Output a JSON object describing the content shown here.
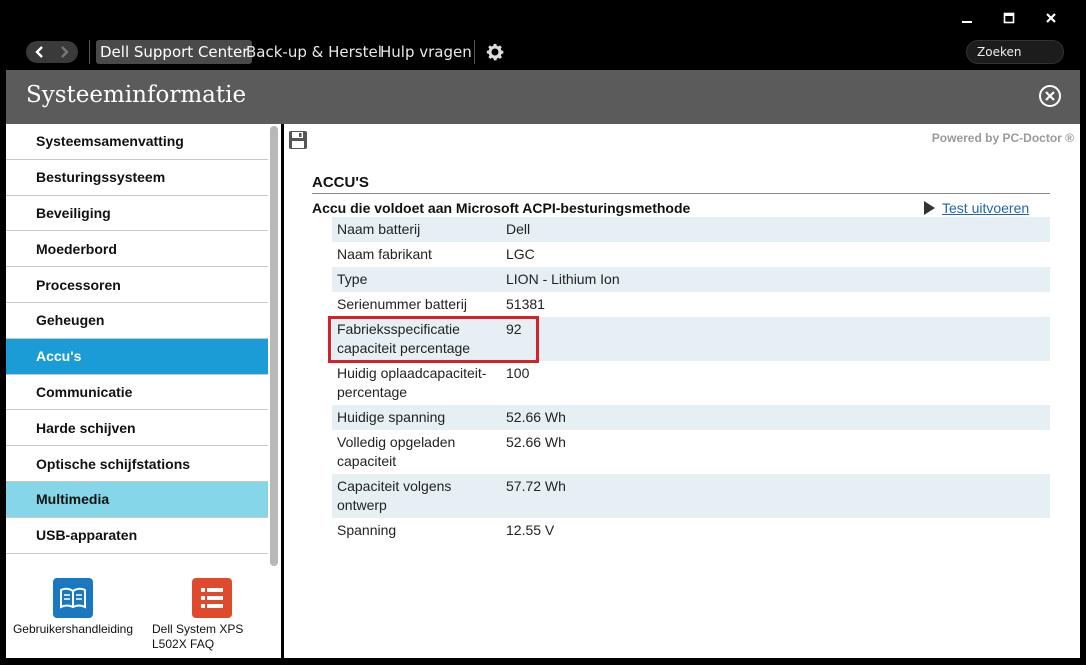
{
  "nav": {
    "items": [
      "Dell Support Center",
      "Back-up & Herstel",
      "Hulp vragen"
    ],
    "search_label": "Zoeken"
  },
  "header": {
    "title": "Systeeminformatie"
  },
  "sidebar": {
    "items": [
      {
        "label": "Systeemsamenvatting"
      },
      {
        "label": "Besturingssysteem"
      },
      {
        "label": "Beveiliging"
      },
      {
        "label": "Moederbord"
      },
      {
        "label": "Processoren"
      },
      {
        "label": "Geheugen"
      },
      {
        "label": "Accu's"
      },
      {
        "label": "Communicatie"
      },
      {
        "label": "Harde schijven"
      },
      {
        "label": "Optische schijfstations"
      },
      {
        "label": "Multimedia"
      },
      {
        "label": "USB-apparaten"
      }
    ],
    "selected_index": 6,
    "hover_index": 10,
    "footer": {
      "manual_label": "Gebruikershandleiding",
      "faq_label": "Dell System XPS L502X FAQ"
    }
  },
  "main": {
    "powered_by": "Powered by PC-Doctor ®",
    "section_title": "ACCU'S",
    "subtitle": "Accu die voldoet aan Microsoft ACPI-besturingsmethode",
    "test_link": "Test uitvoeren",
    "rows": [
      {
        "key": "Naam batterij",
        "value": "Dell"
      },
      {
        "key": "Naam fabrikant",
        "value": "LGC"
      },
      {
        "key": "Type",
        "value": "LION - Lithium Ion"
      },
      {
        "key": "Serienummer batterij",
        "value": "51381"
      },
      {
        "key": "Fabrieksspecificatie capaciteit percentage",
        "value": "92"
      },
      {
        "key": "Huidig oplaadcapaciteit-percentage",
        "value": "100"
      },
      {
        "key": "Huidige spanning",
        "value": "52.66 Wh"
      },
      {
        "key": "Volledig opgeladen capaciteit",
        "value": "52.66 Wh"
      },
      {
        "key": "Capaciteit volgens ontwerp",
        "value": "57.72 Wh"
      },
      {
        "key": "Spanning",
        "value": "12.55 V"
      }
    ]
  },
  "colors": {
    "selected": "#1b9cd6",
    "hover": "#85d6e8",
    "highlight_border": "#d6202a",
    "row_shade": "#e6f0f4"
  }
}
